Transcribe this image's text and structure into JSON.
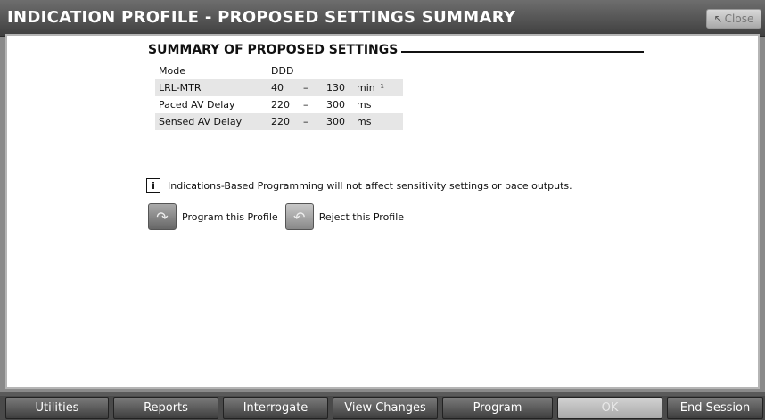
{
  "window": {
    "title": "INDICATION PROFILE - PROPOSED SETTINGS SUMMARY",
    "close_label": "Close"
  },
  "summary": {
    "title": "SUMMARY OF PROPOSED SETTINGS",
    "rows": [
      {
        "label": "Mode",
        "value": "DDD",
        "sep": "",
        "upper": "",
        "unit": ""
      },
      {
        "label": "LRL-MTR",
        "value": "40",
        "sep": "–",
        "upper": "130",
        "unit": "min⁻¹"
      },
      {
        "label": "Paced AV Delay",
        "value": "220",
        "sep": "–",
        "upper": "300",
        "unit": "ms"
      },
      {
        "label": "Sensed AV Delay",
        "value": "220",
        "sep": "–",
        "upper": "300",
        "unit": "ms"
      }
    ]
  },
  "note": {
    "icon": "info-icon",
    "text": "Indications-Based Programming will not affect sensitivity settings or pace outputs."
  },
  "actions": {
    "program_label": "Program this Profile",
    "reject_label": "Reject this Profile"
  },
  "toolbar": {
    "utilities": "Utilities",
    "reports": "Reports",
    "interrogate": "Interrogate",
    "view_changes": "View Changes",
    "program": "Program",
    "ok": "OK",
    "end_session": "End Session"
  }
}
